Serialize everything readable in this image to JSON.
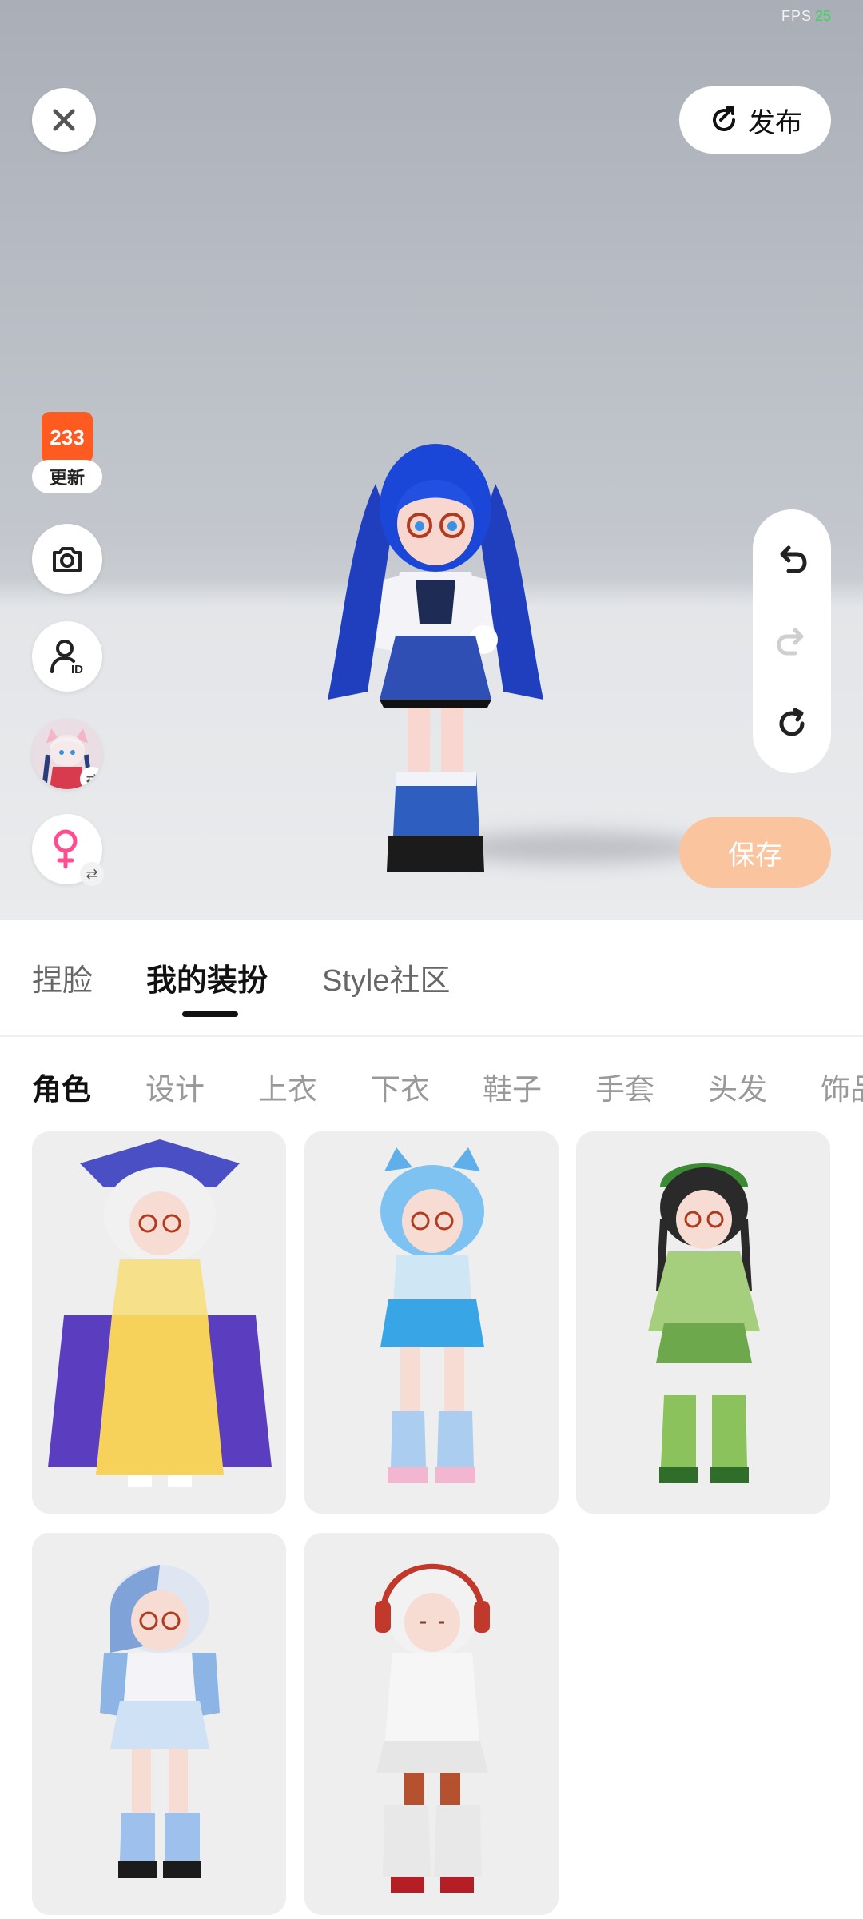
{
  "status": {
    "fps_label": "FPS",
    "fps_value": "25"
  },
  "topbar": {
    "close_icon": "close-icon",
    "publish_label": "发布",
    "publish_icon": "publish-icon"
  },
  "left_tools": {
    "logo_text": "233",
    "logo_badge": "更新"
  },
  "right_tools": {
    "undo_icon": "undo-icon",
    "redo_icon": "redo-icon",
    "reset_icon": "reset-icon",
    "save_label": "保存"
  },
  "main_tabs": {
    "tab1": "捏脸",
    "tab2": "我的装扮",
    "tab3": "Style社区"
  },
  "categories": {
    "c1": "角色",
    "c2": "设计",
    "c3": "上衣",
    "c4": "下衣",
    "c5": "鞋子",
    "c6": "手套",
    "c7": "头发",
    "c8": "饰品"
  },
  "colors": {
    "accent_orange": "#ff5a1f",
    "save_button": "#f9c49e",
    "fps_green": "#3bd45a",
    "gender_pink": "#ff4d8f"
  }
}
